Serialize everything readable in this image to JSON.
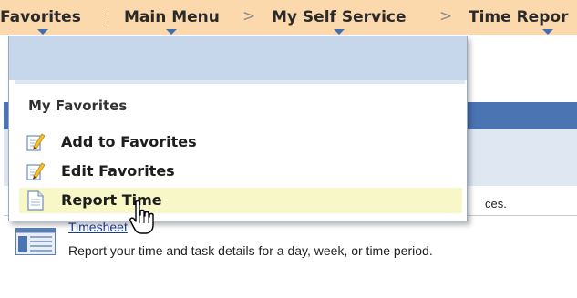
{
  "topbar": {
    "favorites_label": "Favorites",
    "crumbs": [
      "Main Menu",
      "My Self Service",
      "Time Repor"
    ],
    "separator": ">",
    "background_color": "#fcd9ad",
    "caret_color": "#3f6fb2"
  },
  "favorites_menu": {
    "section_title": "My Favorites",
    "items": [
      {
        "label": "Add to Favorites",
        "icon": "pencil-edit-icon"
      },
      {
        "label": "Edit Favorites",
        "icon": "pencil-edit-icon"
      },
      {
        "label": "Report Time",
        "icon": "document-icon",
        "hovered": true
      }
    ],
    "header_band_color": "#c6d7ec",
    "highlight_color": "#f7f7c8"
  },
  "background": {
    "snippet_text": "ces.",
    "link_text": "Timesheet",
    "description": "Report your time and task details for a day, week, or time period.",
    "header_bar_color": "#4a74b2",
    "panel_color": "#dfe7f2"
  },
  "cursor": {
    "icon": "hand-pointer-cursor-icon"
  }
}
